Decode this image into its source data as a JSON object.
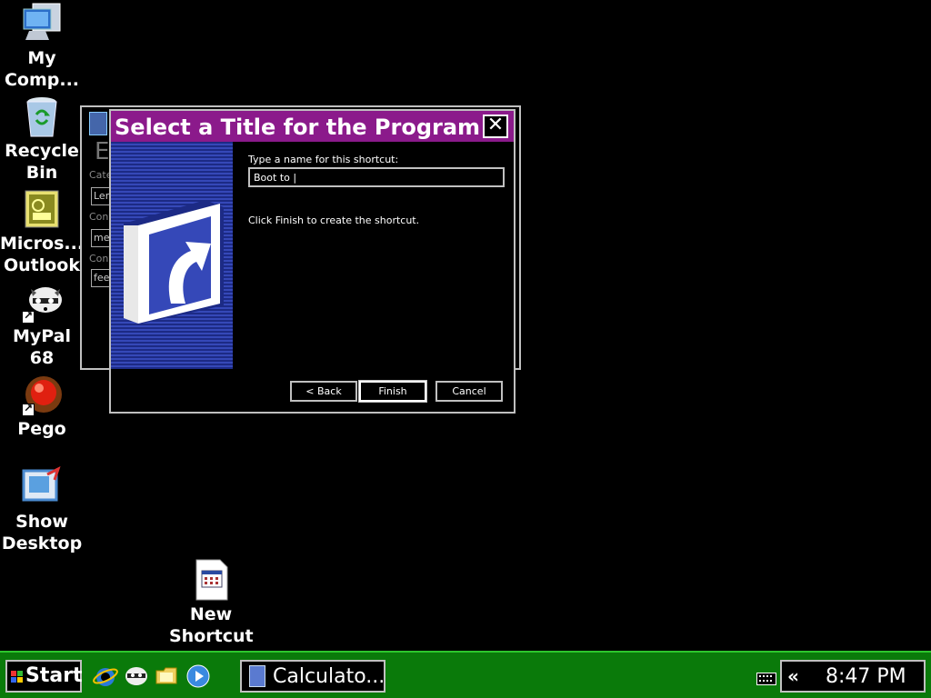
{
  "desktop": {
    "icons": [
      {
        "label": "My\nComp...",
        "icon": "my-computer-icon"
      },
      {
        "label": "Recycle\nBin",
        "icon": "recycle-bin-icon"
      },
      {
        "label": "Micros...\nOutlook",
        "icon": "outlook-icon"
      },
      {
        "label": "MyPal\n68",
        "icon": "mypal-raccoon-icon"
      },
      {
        "label": "Pego",
        "icon": "pego-red-ball-icon"
      },
      {
        "label": "Show\nDesktop",
        "icon": "show-desktop-icon"
      },
      {
        "label": "New\nShortcut",
        "icon": "new-shortcut-file-icon"
      }
    ]
  },
  "back_window": {
    "heading": "E",
    "labels": [
      "Cate",
      "Conv",
      "Conv"
    ],
    "fields": [
      "Len",
      "met",
      "feet"
    ]
  },
  "dialog": {
    "title": "Select a Title for the Program",
    "close": "✕",
    "prompt": "Type a name for this shortcut:",
    "name_value": "Boot to |",
    "hint": "Click Finish to create the shortcut.",
    "buttons": {
      "back": "< Back",
      "finish": "Finish",
      "cancel": "Cancel"
    }
  },
  "taskbar": {
    "start_label": "Start",
    "quick_launch": [
      "internet-explorer-icon",
      "mypal-icon",
      "folder-icon",
      "media-player-icon"
    ],
    "task": {
      "label": "Calculato..."
    },
    "tray": {
      "chevron": "«",
      "clock": "8:47 PM"
    }
  },
  "colors": {
    "title_bar": "#8b1a8b",
    "taskbar": "#0a7a0a",
    "banner": "#3548b8"
  }
}
